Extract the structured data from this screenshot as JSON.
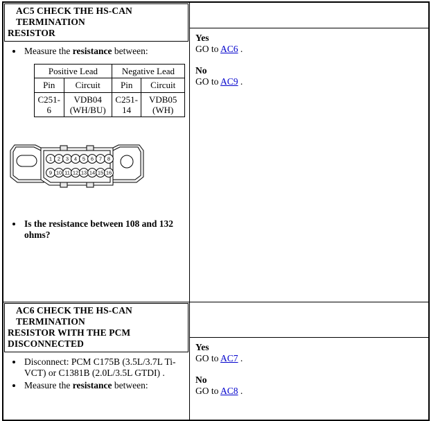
{
  "document": {
    "type": "diagnostic-pinpoint-test",
    "link_color": "#0000cc",
    "text_color": "#000000",
    "border_color": "#000000"
  },
  "steps": [
    {
      "id": "AC5",
      "title_lines": [
        "AC5 CHECK THE HS-CAN TERMINATION",
        "RESISTOR"
      ],
      "instructions": [
        {
          "segments": [
            {
              "text": "Measure the ",
              "bold": false
            },
            {
              "text": "resistance",
              "bold": true
            },
            {
              "text": " between:",
              "bold": false
            }
          ]
        }
      ],
      "lead_table": {
        "group_headers": [
          "Positive Lead",
          "Negative Lead"
        ],
        "column_headers": [
          "Pin",
          "Circuit",
          "Pin",
          "Circuit"
        ],
        "rows": [
          {
            "positive_pin": "C251-6",
            "positive_circuit": "VDB04 (WH/BU)",
            "negative_pin": "C251-14",
            "negative_circuit": "VDB05 (WH)"
          }
        ]
      },
      "connector": {
        "name": "data-link-connector-16-pin",
        "top_row_pins": [
          "1",
          "2",
          "3",
          "4",
          "5",
          "6",
          "7",
          "8"
        ],
        "bottom_row_pins": [
          "9",
          "10",
          "11",
          "12",
          "13",
          "14",
          "15",
          "16"
        ]
      },
      "question": "Is the resistance between 108 and 132 ohms?",
      "answers": [
        {
          "label": "Yes",
          "prefix": "GO to ",
          "link": "AC6",
          "suffix": " ."
        },
        {
          "label": "No",
          "prefix": "GO to ",
          "link": "AC9",
          "suffix": " ."
        }
      ]
    },
    {
      "id": "AC6",
      "title_lines": [
        "AC6 CHECK THE HS-CAN TERMINATION",
        "RESISTOR WITH THE PCM",
        "DISCONNECTED"
      ],
      "instructions": [
        {
          "segments": [
            {
              "text": "Disconnect: PCM C175B (3.5L/3.7L Ti-VCT) or C1381B (2.0L/3.5L GTDI) .",
              "bold": false
            }
          ]
        },
        {
          "segments": [
            {
              "text": "Measure the ",
              "bold": false
            },
            {
              "text": "resistance",
              "bold": true
            },
            {
              "text": " between:",
              "bold": false
            }
          ]
        }
      ],
      "answers": [
        {
          "label": "Yes",
          "prefix": "GO to ",
          "link": "AC7",
          "suffix": " ."
        },
        {
          "label": "No",
          "prefix": "GO to ",
          "link": "AC8",
          "suffix": " ."
        }
      ]
    }
  ]
}
